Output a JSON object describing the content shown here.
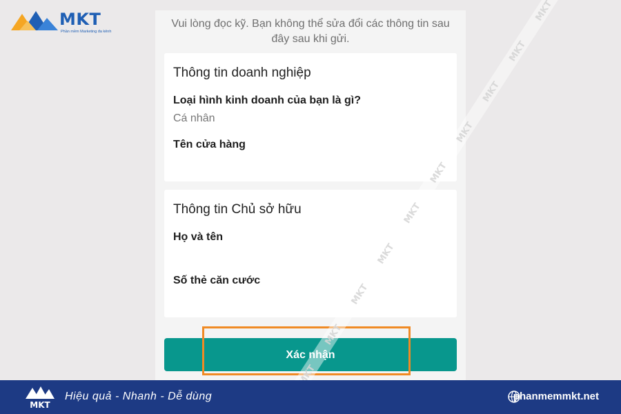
{
  "brand": {
    "name": "MKT",
    "tagline": "Phần mềm Marketing đa kênh",
    "colors": {
      "primary": "#1f5fb4",
      "accent": "#f5a623",
      "footer": "#1d3a84"
    }
  },
  "form": {
    "notice": "Vui lòng đọc kỹ. Bạn không thể sửa đổi các thông tin sau đây sau khi gửi.",
    "business_section": {
      "title": "Thông tin doanh nghiệp",
      "business_type_label": "Loại hình kinh doanh của bạn là gì?",
      "business_type_value": "Cá nhân",
      "store_name_label": "Tên cửa hàng"
    },
    "owner_section": {
      "title": "Thông tin Chủ sở hữu",
      "full_name_label": "Họ và tên",
      "id_card_label": "Số thẻ căn cước"
    },
    "confirm_label": "Xác nhận",
    "confirm_color": "#08978d",
    "highlight_color": "#f08a24"
  },
  "watermark": {
    "text": "MKT"
  },
  "footer": {
    "slogan": "Hiệu quả - Nhanh - Dễ dùng",
    "website": "phanmemmkt.net",
    "icon": "globe-icon"
  }
}
